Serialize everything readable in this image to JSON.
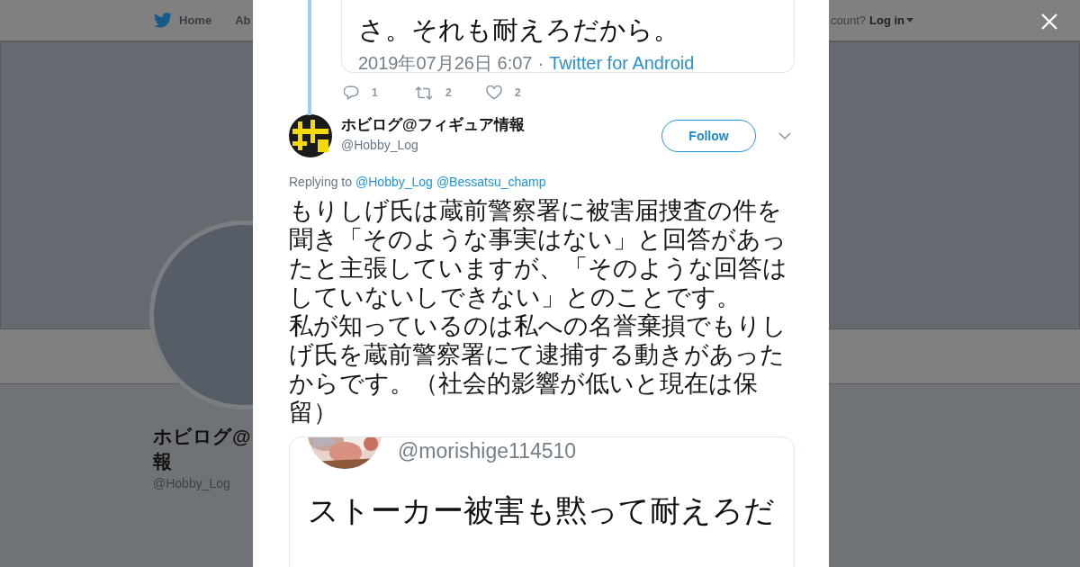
{
  "background_page": {
    "nav": {
      "items": [
        {
          "label": "Home",
          "kind": "home"
        },
        {
          "label": "Ab",
          "kind": "link"
        }
      ],
      "login_prompt": "count?",
      "login": "Log in"
    },
    "profile": {
      "name_lines": [
        "ホビログ@",
        "報"
      ],
      "handle": "@Hobby_Log"
    }
  },
  "modal": {
    "attached_image": {
      "text": "さ。それも耐えろだから。",
      "timestamp": "2019年07月26日 6:07",
      "separator": "·",
      "source": "Twitter for Android",
      "actions": [
        {
          "kind": "reply",
          "count": "1"
        },
        {
          "kind": "retweet",
          "count": "2"
        },
        {
          "kind": "like",
          "count": "2"
        }
      ]
    },
    "tweet": {
      "name": "ホビログ@フィギュア情報",
      "handle": "@Hobby_Log",
      "follow": "Follow",
      "replying_label": "Replying to",
      "mentions": [
        "@Hobby_Log",
        "@Bessatsu_champ"
      ],
      "paragraphs": [
        "もりしげ氏は蔵前警察署に被害届捜査の件を聞き「そのような事実はない」と回答があったと主張していますが、「そのような回答はしていないしできない」とのことです。",
        "私が知っているのは私への名誉棄損でもりしげ氏を蔵前警察署にて逮捕する動きがあったからです。（社会的影響が低いと現在は保留）"
      ],
      "quote": {
        "handle": "@morishige114510",
        "lines": [
          "ストーカー被害も黙って耐えろだ"
        ]
      }
    }
  }
}
